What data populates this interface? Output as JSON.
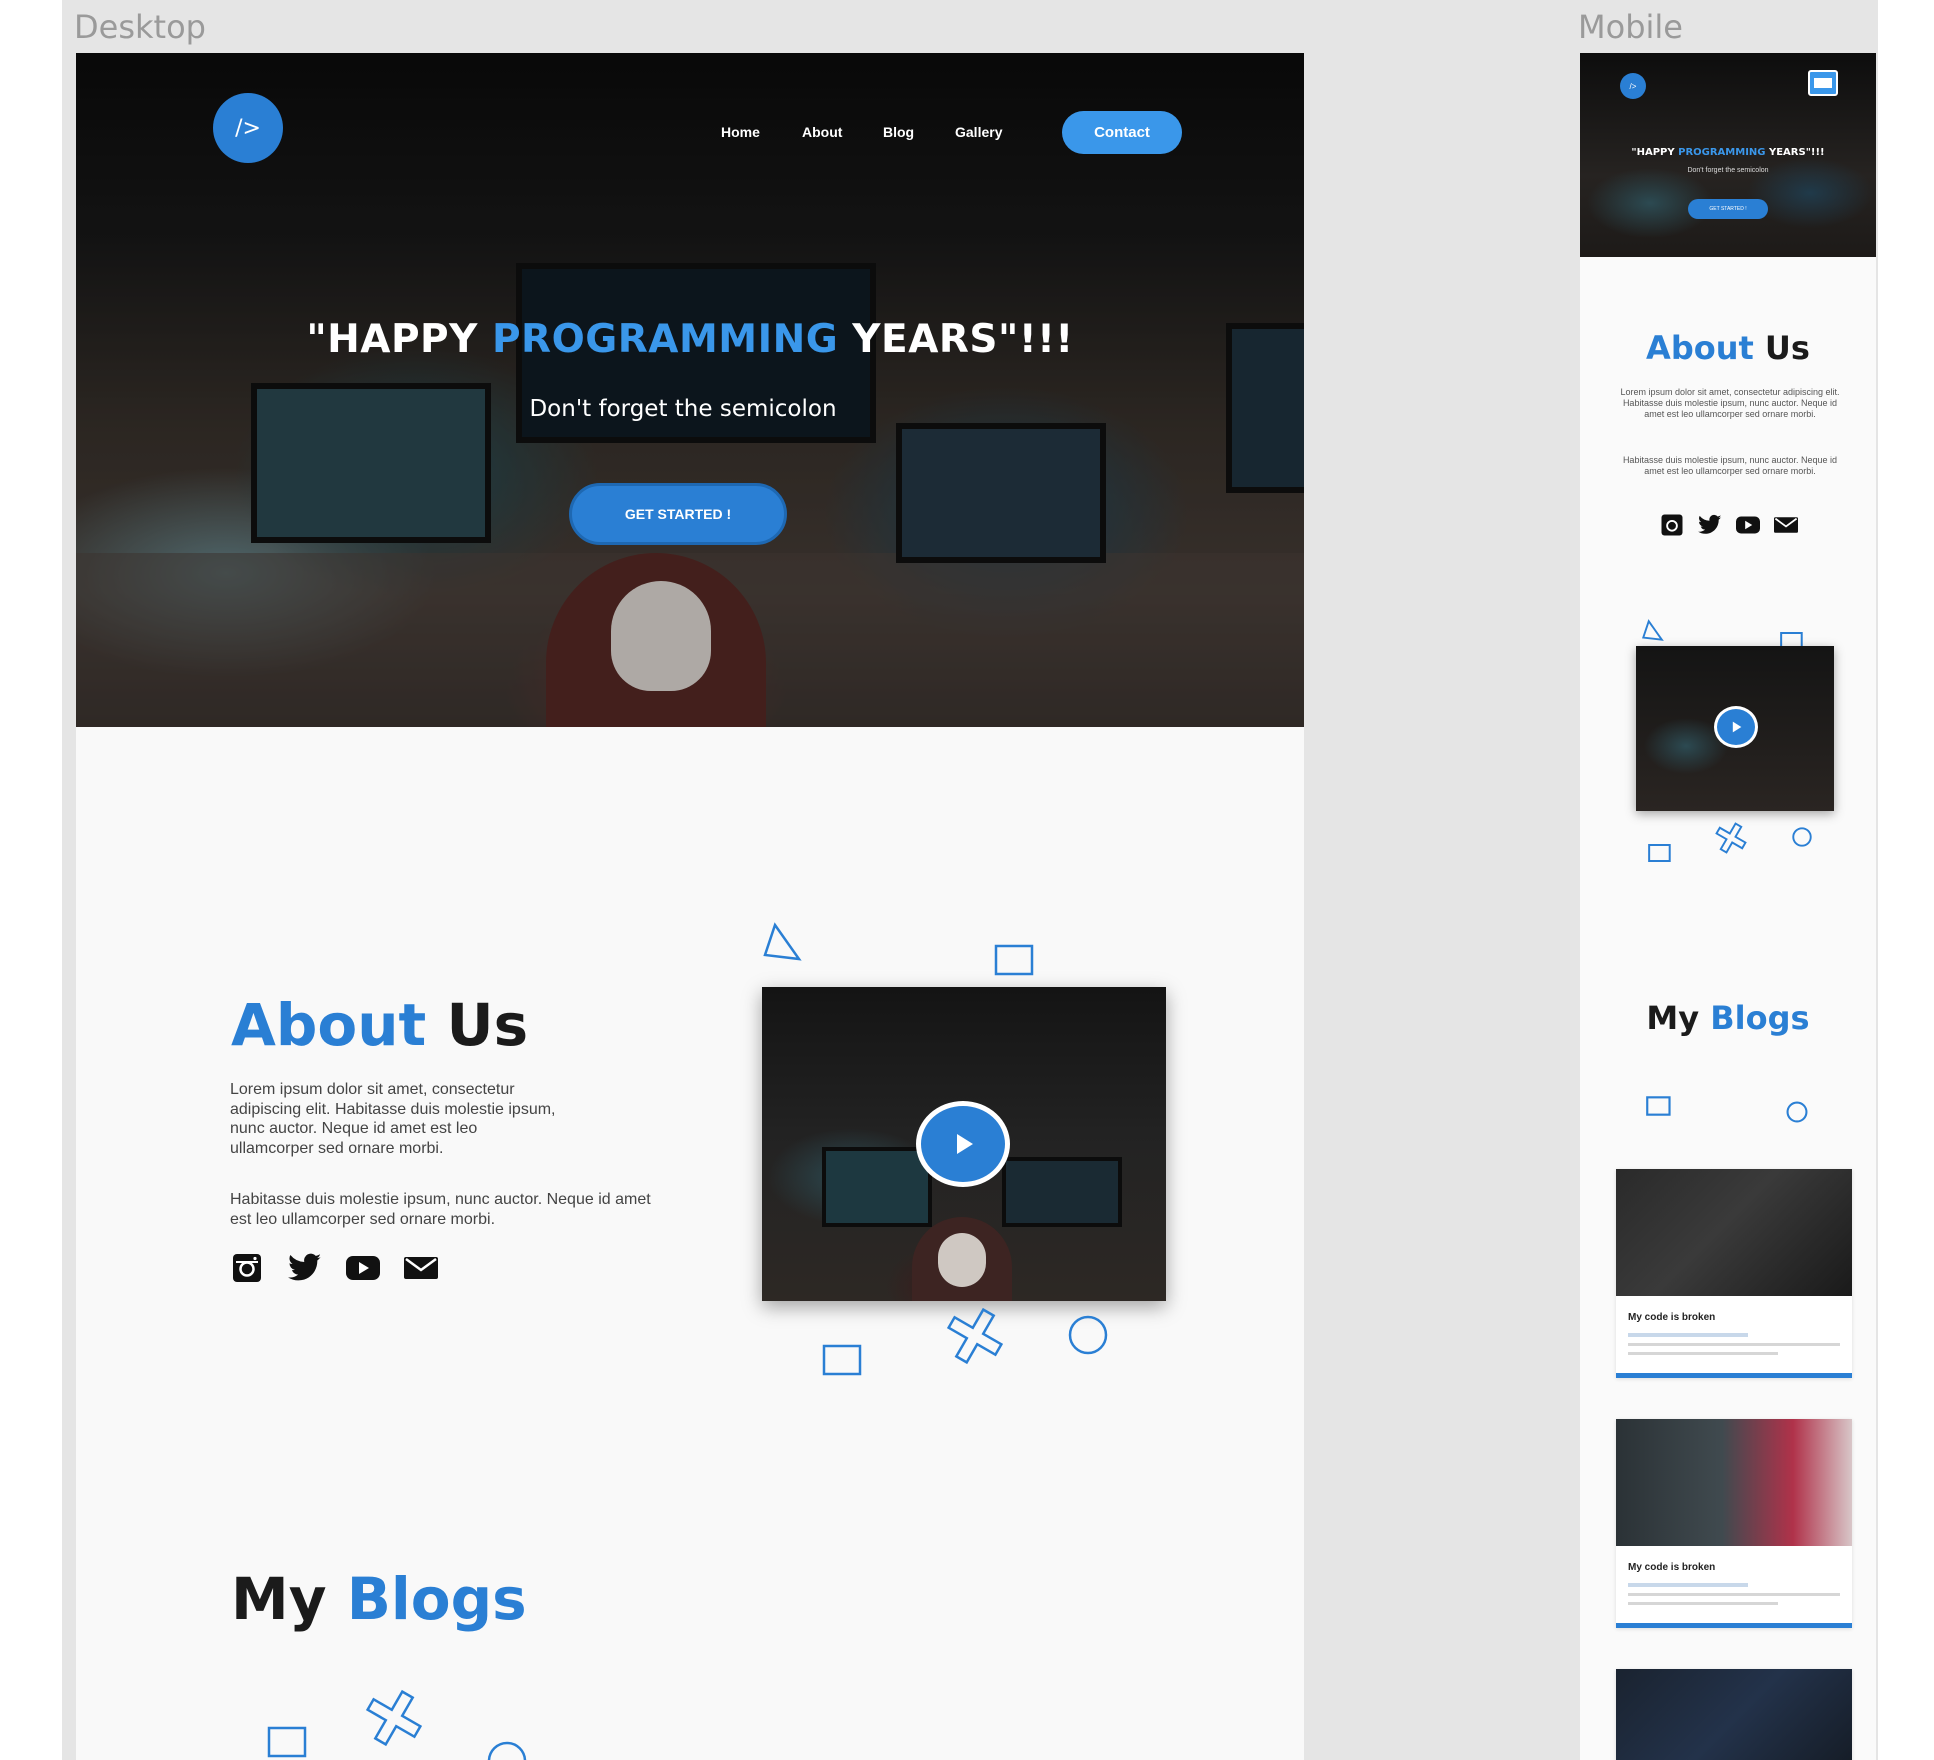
{
  "frames": {
    "desktop_label": "Desktop",
    "mobile_label": "Mobile"
  },
  "logo": {
    "text": "/>"
  },
  "nav": {
    "items": [
      "Home",
      "About",
      "Blog",
      "Gallery"
    ],
    "contact": "Contact"
  },
  "hero": {
    "title_pre": "\"HAPPY ",
    "title_highlight": "PROGRAMMING",
    "title_post": " YEARS\"!!!",
    "subtitle": "Don't forget the semicolon",
    "cta": "GET STARTED !"
  },
  "about": {
    "heading_blue": "About",
    "heading_dark": " Us",
    "para1": "Lorem ipsum dolor sit amet, consectetur adipiscing elit. Habitasse duis molestie ipsum, nunc auctor. Neque id amet est leo ullamcorper sed ornare morbi.",
    "para2": "Habitasse duis molestie ipsum, nunc auctor. Neque id amet est leo ullamcorper sed ornare morbi."
  },
  "social": {
    "icons": [
      "instagram-icon",
      "twitter-icon",
      "youtube-icon",
      "mail-icon"
    ]
  },
  "blogs": {
    "heading_dark": "My ",
    "heading_blue": "Blogs",
    "cards": [
      {
        "title": "My code is broken"
      },
      {
        "title": "My code is broken"
      }
    ]
  },
  "colors": {
    "accent": "#2a7fd4",
    "accent_light": "#3a97ea",
    "dark": "#1b1b1b"
  }
}
